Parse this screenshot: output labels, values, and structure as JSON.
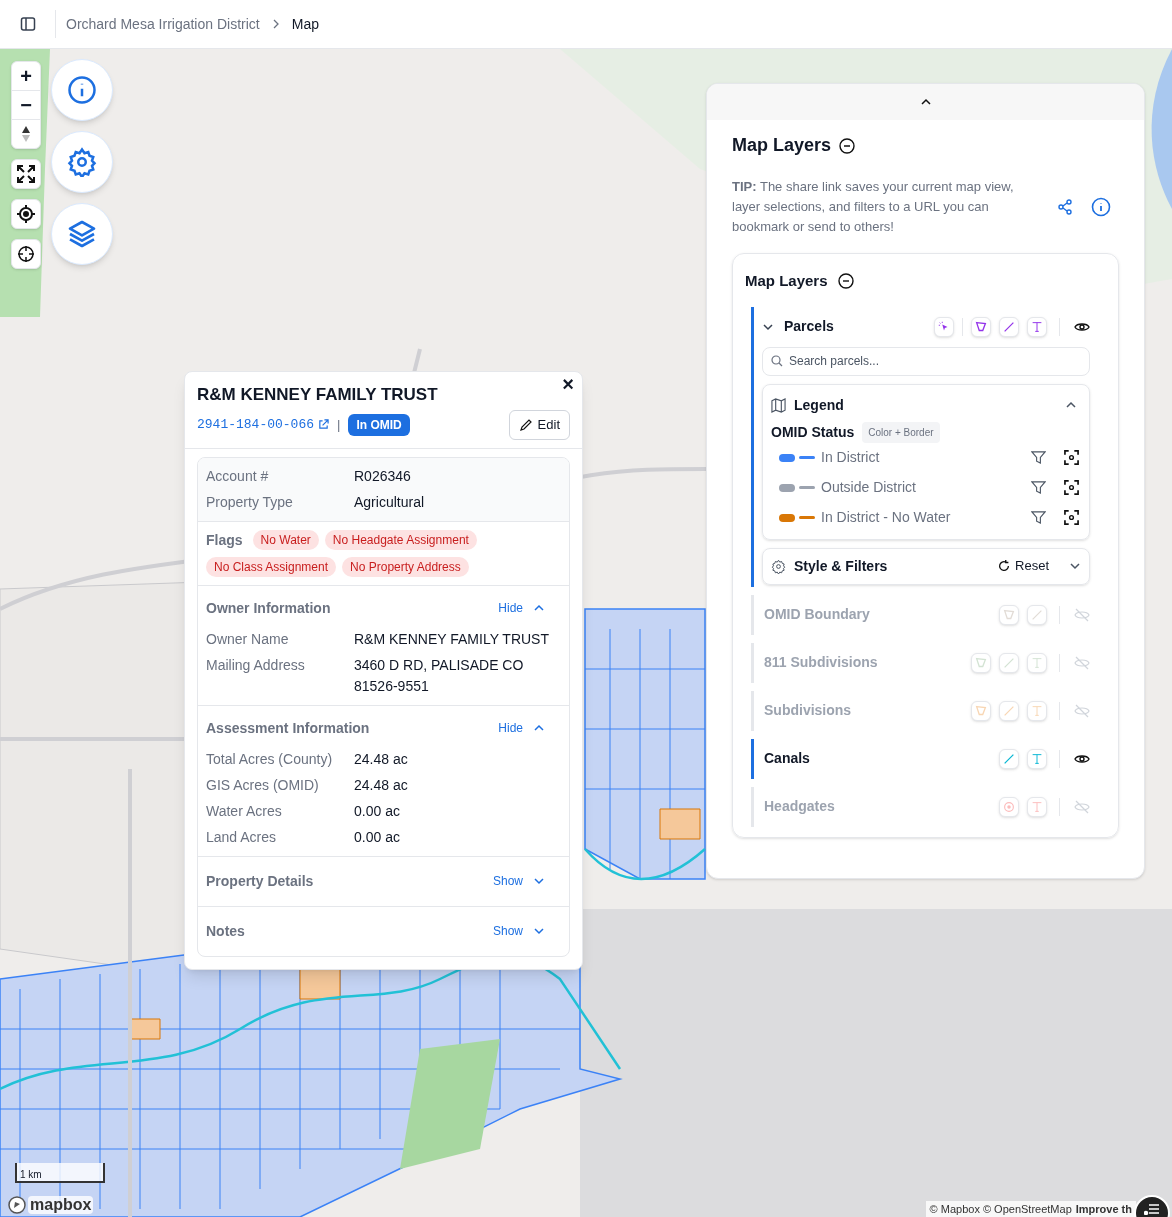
{
  "breadcrumb": [
    {
      "label": "Orchard Mesa Irrigation District",
      "current": false
    },
    {
      "label": "Map",
      "current": true
    }
  ],
  "map_controls": {
    "zoom_in": "+",
    "zoom_out": "−"
  },
  "scale": "1 km",
  "logo": "mapbox",
  "attribution": {
    "text": "© Mapbox © OpenStreetMap",
    "link": "Improve th"
  },
  "popup": {
    "title": "R&M KENNEY FAMILY TRUST",
    "parcel_id": "2941-184-00-066",
    "separator": "|",
    "badge": "In OMID",
    "edit": "Edit",
    "close": "×",
    "summary": [
      {
        "label": "Account #",
        "value": "R026346"
      },
      {
        "label": "Property Type",
        "value": "Agricultural"
      }
    ],
    "flags_label": "Flags",
    "flags": [
      "No Water",
      "No Headgate Assignment",
      "No Class Assignment",
      "No Property Address"
    ],
    "sections": [
      {
        "title": "Owner Information",
        "toggle": "Hide",
        "expanded": true,
        "rows": [
          {
            "label": "Owner Name",
            "value": "R&M KENNEY FAMILY TRUST"
          },
          {
            "label": "Mailing Address",
            "value": "3460 D RD, PALISADE CO 81526-9551"
          }
        ]
      },
      {
        "title": "Assessment Information",
        "toggle": "Hide",
        "expanded": true,
        "rows": [
          {
            "label": "Total Acres (County)",
            "value": "24.48 ac"
          },
          {
            "label": "GIS Acres (OMID)",
            "value": "24.48 ac"
          },
          {
            "label": "Water Acres",
            "value": "0.00 ac"
          },
          {
            "label": "Land Acres",
            "value": "0.00 ac"
          }
        ]
      },
      {
        "title": "Property Details",
        "toggle": "Show",
        "expanded": false
      },
      {
        "title": "Notes",
        "toggle": "Show",
        "expanded": false
      }
    ]
  },
  "panel": {
    "title": "Map Layers",
    "tip": "**TIP:** The share link saves your current map view, layer selections, and filters to a URL you can bookmark or send to others!",
    "layers_title": "Map Layers",
    "layers": [
      {
        "name": "Parcels",
        "visible": true,
        "expanded": true,
        "color": "#9333ea",
        "tools": [
          {
            "kind": "select"
          },
          {
            "kind": "polygon"
          },
          {
            "kind": "line"
          },
          {
            "kind": "text"
          }
        ],
        "search_placeholder": "Search parcels...",
        "legend": {
          "title": "Legend",
          "expanded": true,
          "field": "OMID Status",
          "mode": "Color + Border",
          "items": [
            {
              "label": "In District",
              "color": "#3b82f6"
            },
            {
              "label": "Outside District",
              "color": "#9ca3af"
            },
            {
              "label": "In District - No Water",
              "color": "#d97706"
            }
          ]
        },
        "style": {
          "title": "Style & Filters",
          "reset": "Reset",
          "expanded": false
        }
      },
      {
        "name": "OMID Boundary",
        "visible": false,
        "expanded": false,
        "color": "#e2dcd6",
        "tools": [
          {
            "kind": "polygon"
          },
          {
            "kind": "line"
          }
        ]
      },
      {
        "name": "811 Subdivisions",
        "visible": false,
        "expanded": false,
        "color": "#d3e3d3",
        "tools": [
          {
            "kind": "polygon"
          },
          {
            "kind": "line"
          },
          {
            "kind": "text"
          }
        ]
      },
      {
        "name": "Subdivisions",
        "visible": false,
        "expanded": false,
        "color": "#f8d6b3",
        "tools": [
          {
            "kind": "polygon"
          },
          {
            "kind": "line"
          },
          {
            "kind": "text"
          }
        ]
      },
      {
        "name": "Canals",
        "visible": true,
        "expanded": false,
        "color": "#06b6d4",
        "tools": [
          {
            "kind": "line"
          },
          {
            "kind": "text"
          }
        ]
      },
      {
        "name": "Headgates",
        "visible": false,
        "expanded": false,
        "color": "#fcbcbc",
        "tools": [
          {
            "kind": "point"
          },
          {
            "kind": "text"
          }
        ]
      }
    ]
  }
}
